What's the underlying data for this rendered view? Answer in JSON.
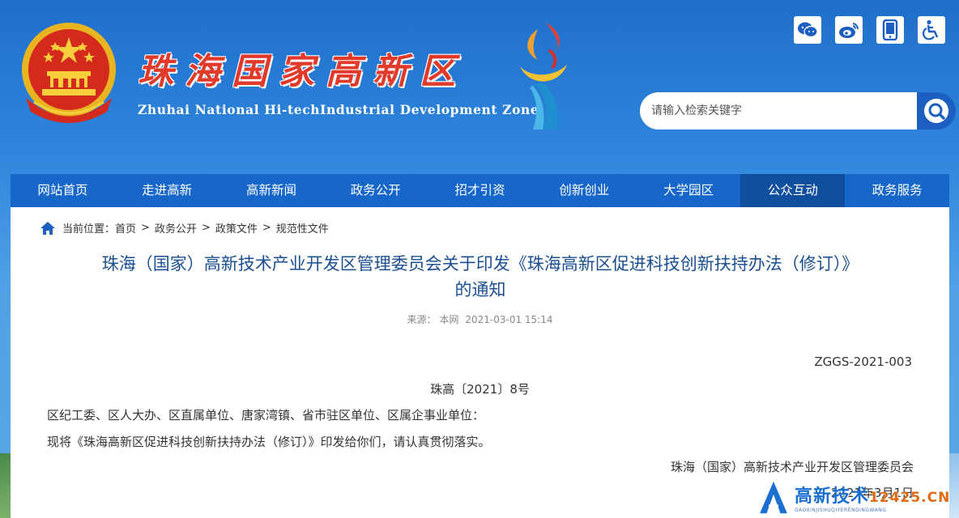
{
  "header": {
    "cn_title": "珠海国家高新区",
    "en_title": "Zhuhai National Hi-techIndustrial Development Zone",
    "icons": [
      "wechat-icon",
      "weibo-icon",
      "mobile-icon",
      "accessibility-icon"
    ]
  },
  "search": {
    "placeholder": "请输入检索关键字"
  },
  "nav": {
    "items": [
      {
        "label": "网站首页"
      },
      {
        "label": "走进高新"
      },
      {
        "label": "高新新闻"
      },
      {
        "label": "政务公开"
      },
      {
        "label": "招才引资"
      },
      {
        "label": "创新创业"
      },
      {
        "label": "大学园区"
      },
      {
        "label": "公众互动"
      },
      {
        "label": "政务服务"
      }
    ],
    "active_index": 7
  },
  "breadcrumb": {
    "prefix": "当前位置：",
    "items": [
      "首页",
      "政务公开",
      "政策文件",
      "规范性文件"
    ],
    "separator": ">"
  },
  "article": {
    "title_line1": "珠海（国家）高新技术产业开发区管理委员会关于印发《珠海高新区促进科技创新扶持办法（修订）》",
    "title_line2": "的通知",
    "source_label": "来源：",
    "source": "本网",
    "datetime": "2021-03-01 15:14",
    "doc_code": "ZGGS-2021-003",
    "doc_number": "珠高〔2021〕8号",
    "recipients": "区纪工委、区人大办、区直属单位、唐家湾镇、省市驻区单位、区属企事业单位：",
    "body": "现将《珠海高新区促进科技创新扶持办法（修订）》印发给你们，请认真贯彻落实。",
    "signature": "珠海（国家）高新技术产业开发区管理委员会",
    "date": "2021年3月1日"
  },
  "watermark": {
    "main": "高新技术",
    "domain": "12425.CN",
    "sub": "GAOXINJISHUQIYERENDINGWANG"
  },
  "colors": {
    "nav_bg": "#1667c9",
    "nav_active": "#0f4f9e",
    "title_red": "#e23a2a",
    "article_title": "#1b4f93"
  }
}
